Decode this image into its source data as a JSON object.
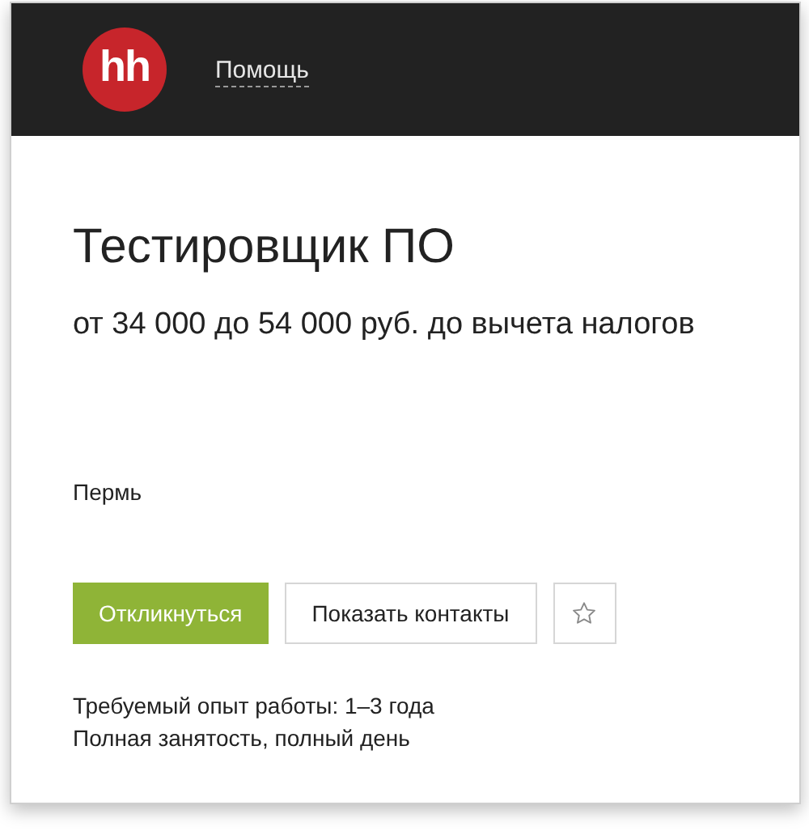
{
  "header": {
    "logo": "hh",
    "help_link": "Помощь"
  },
  "vacancy": {
    "title": "Тестировщик ПО",
    "salary": "от 34 000 до 54 000 руб. до вычета налогов",
    "city": "Пермь",
    "buttons": [
      {
        "kind": "primary",
        "label": "Откликнуться"
      },
      {
        "kind": "secondary",
        "label": "Показать контакты"
      },
      {
        "kind": "favorite"
      }
    ],
    "details": [
      "Требуемый опыт работы: 1–3 года",
      "Полная занятость, полный день"
    ]
  }
}
